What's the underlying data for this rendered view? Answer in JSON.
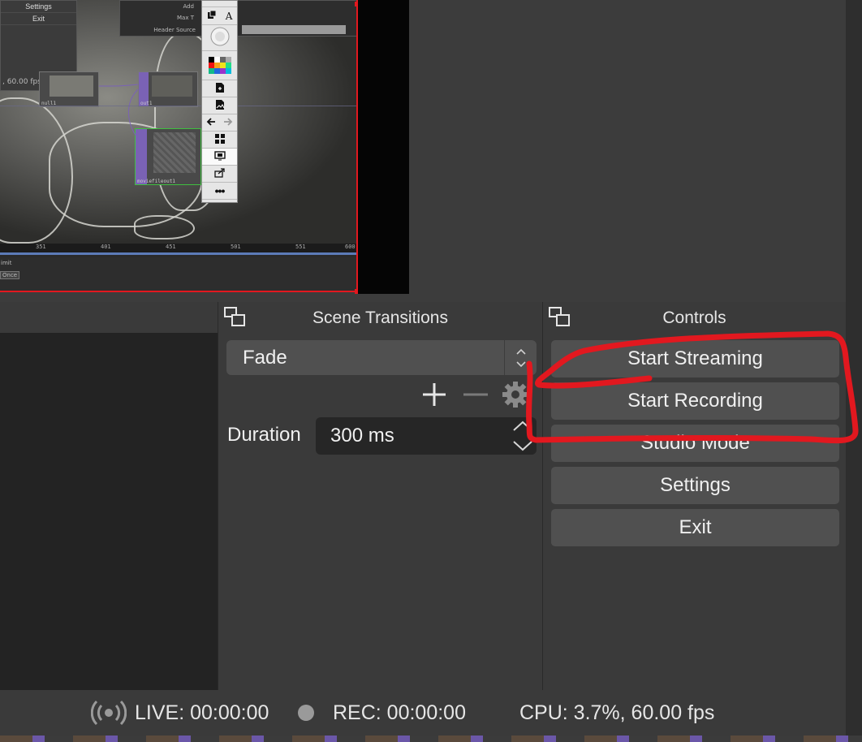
{
  "preview": {
    "menu_items": [
      "Settings",
      "Exit"
    ],
    "menu_fps": ", 60.00 fps",
    "header_panel_labels": [
      "Add",
      "Max T",
      "Header Source"
    ],
    "nodes": [
      "null1",
      "out1",
      "moviefileout1"
    ],
    "timeline_ticks": [
      "351",
      "401",
      "451",
      "501",
      "551",
      "600"
    ],
    "bottom_labels": [
      "imit",
      "Once"
    ],
    "palette_glyph": "A"
  },
  "scene_transitions": {
    "title": "Scene Transitions",
    "selected": "Fade",
    "duration_label": "Duration",
    "duration_value": "300 ms"
  },
  "controls": {
    "title": "Controls",
    "buttons": [
      "Start Streaming",
      "Start Recording",
      "Studio Mode",
      "Settings",
      "Exit"
    ]
  },
  "status": {
    "live": "LIVE: 00:00:00",
    "rec": "REC: 00:00:00",
    "cpu": "CPU: 3.7%, 60.00 fps"
  },
  "colors": {
    "annotation": "#e2181f",
    "panel_bg": "#3a3a3a",
    "button_bg": "#505050"
  }
}
